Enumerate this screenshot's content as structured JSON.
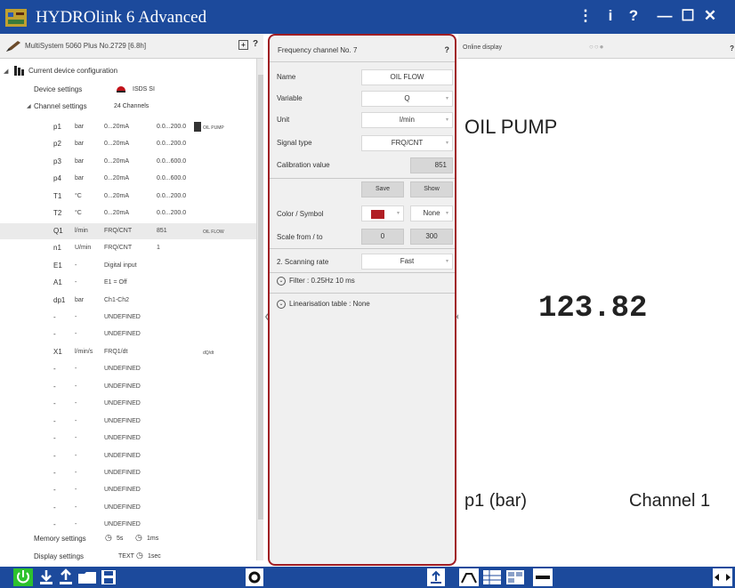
{
  "app": {
    "title": "HYDROlink 6 Advanced"
  },
  "titlebar": {
    "menu_icon": "⋮",
    "info_icon": "i",
    "help_icon": "?",
    "minimize_icon": "—",
    "maximize_icon": "☐",
    "close_icon": "✕"
  },
  "left": {
    "device_title": "MultiSystem 5060 Plus No.2729 [6.8h]",
    "help": "?",
    "expand": "+",
    "tree": {
      "current_config": "Current device configuration",
      "device_settings": "Device settings",
      "device_settings_value": "ISDS SI",
      "channel_settings": "Channel settings",
      "channel_settings_value": "24 Channels",
      "channels": [
        {
          "ch": "p1",
          "unit": "bar",
          "signal": "0...20mA",
          "range": "0.0...200.0",
          "name": "OIL PUMP"
        },
        {
          "ch": "p2",
          "unit": "bar",
          "signal": "0...20mA",
          "range": "0.0...200.0",
          "name": ""
        },
        {
          "ch": "p3",
          "unit": "bar",
          "signal": "0...20mA",
          "range": "0.0...600.0",
          "name": ""
        },
        {
          "ch": "p4",
          "unit": "bar",
          "signal": "0...20mA",
          "range": "0.0...600.0",
          "name": ""
        },
        {
          "ch": "T1",
          "unit": "°C",
          "signal": "0...20mA",
          "range": "0.0...200.0",
          "name": ""
        },
        {
          "ch": "T2",
          "unit": "°C",
          "signal": "0...20mA",
          "range": "0.0...200.0",
          "name": ""
        },
        {
          "ch": "Q1",
          "unit": "l/min",
          "signal": "FRQ/CNT",
          "range": "851",
          "name": "OIL FLOW"
        },
        {
          "ch": "n1",
          "unit": "U/min",
          "signal": "FRQ/CNT",
          "range": "1",
          "name": ""
        },
        {
          "ch": "E1",
          "unit": "-",
          "signal": "Digital input",
          "range": "",
          "name": ""
        },
        {
          "ch": "A1",
          "unit": "-",
          "signal": "E1 = Off",
          "range": "",
          "name": ""
        },
        {
          "ch": "dp1",
          "unit": "bar",
          "signal": "Ch1-Ch2",
          "range": "",
          "name": ""
        },
        {
          "ch": "-",
          "unit": "-",
          "signal": "UNDEFINED",
          "range": "",
          "name": ""
        },
        {
          "ch": "-",
          "unit": "-",
          "signal": "UNDEFINED",
          "range": "",
          "name": ""
        },
        {
          "ch": "X1",
          "unit": "l/min/s",
          "signal": "FRQ1/dt",
          "range": "",
          "name": "dQ/dt"
        },
        {
          "ch": "-",
          "unit": "-",
          "signal": "UNDEFINED",
          "range": "",
          "name": ""
        },
        {
          "ch": "-",
          "unit": "-",
          "signal": "UNDEFINED",
          "range": "",
          "name": ""
        },
        {
          "ch": "-",
          "unit": "-",
          "signal": "UNDEFINED",
          "range": "",
          "name": ""
        },
        {
          "ch": "-",
          "unit": "-",
          "signal": "UNDEFINED",
          "range": "",
          "name": ""
        },
        {
          "ch": "-",
          "unit": "-",
          "signal": "UNDEFINED",
          "range": "",
          "name": ""
        },
        {
          "ch": "-",
          "unit": "-",
          "signal": "UNDEFINED",
          "range": "",
          "name": ""
        },
        {
          "ch": "-",
          "unit": "-",
          "signal": "UNDEFINED",
          "range": "",
          "name": ""
        },
        {
          "ch": "-",
          "unit": "-",
          "signal": "UNDEFINED",
          "range": "",
          "name": ""
        },
        {
          "ch": "-",
          "unit": "-",
          "signal": "UNDEFINED",
          "range": "",
          "name": ""
        },
        {
          "ch": "-",
          "unit": "-",
          "signal": "UNDEFINED",
          "range": "",
          "name": ""
        }
      ],
      "memory_settings": "Memory settings",
      "memory_value_1": "5s",
      "memory_value_2": "1ms",
      "display_settings": "Display settings",
      "display_value_1": "TEXT",
      "display_value_2": "1sec"
    }
  },
  "center": {
    "title": "Frequency channel  No.  7",
    "help": "?",
    "name_label": "Name",
    "name_value": "OIL FLOW",
    "variable_label": "Variable",
    "variable_value": "Q",
    "unit_label": "Unit",
    "unit_value": "l/min",
    "signal_label": "Signal type",
    "signal_value": "FRQ/CNT",
    "calibration_label": "Calibration value",
    "calibration_value": "851",
    "save_label": "Save",
    "show_label": "Show",
    "color_label": "Color / Symbol",
    "symbol_value": "None",
    "scale_label": "Scale from / to",
    "scale_from": "0",
    "scale_to": "300",
    "scanning_label": "2. Scanning rate",
    "scanning_value": "Fast",
    "filter_text": "Filter  :  0.25Hz  10 ms",
    "linearisation_text": "Linearisation table  :  None",
    "color_hex": "#b11e24"
  },
  "right": {
    "title": "Online display",
    "help": "?",
    "display_name": "OIL PUMP",
    "display_value": "123.82",
    "display_unit": "p1 (bar)",
    "display_channel": "Channel 1"
  },
  "colors": {
    "titlebar": "#1c4a9c",
    "highlight_border": "#a01d24",
    "power": "#2ec22e"
  }
}
